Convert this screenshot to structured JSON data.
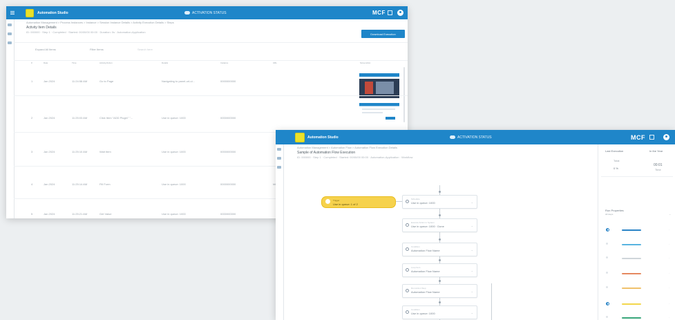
{
  "colors": {
    "background": "#eceff1",
    "topbar": "#1f86c9",
    "primary_button": "#1f86c9",
    "highlight_node": "#f6d24d",
    "legend": [
      "#2a84c6",
      "#58b4e0",
      "#cfd5da",
      "#e5885f",
      "#f0c16b",
      "#f3d64b",
      "#38a67a"
    ]
  },
  "back_window": {
    "topbar": {
      "app_name": "Automation Studio",
      "center_label": "ACTIVATION STATUS",
      "brand": "MCF",
      "icons": [
        "menu-icon",
        "app-logo-icon",
        "cloud-icon",
        "expand-icon",
        "user-avatar-icon"
      ]
    },
    "breadcrumb": "Automation Management  >  Process Instances  >  Instance  >  Session Instance Details  >  Activity Execution Details  >  Steps",
    "page_title": "Activity Item Details",
    "meta_line": "ID: 000000  ·  Step 1  ·  Completed  ·  Started: 00/00/00 00:00  ·  Duration: 0s  ·  Automation-Application",
    "primary_button": "Download Execution",
    "toolbar": {
      "action_1": "Expand All Items",
      "action_2": "Filter Items",
      "search_placeholder": "Search here"
    },
    "table": {
      "columns": [
        "#",
        "Date",
        "Time",
        "Activity/Action",
        "Details",
        "Instance",
        "URL",
        "Screenshot"
      ],
      "rows": [
        {
          "index": "1",
          "date": "Jan 2024",
          "time": "11:24:58 AM",
          "action": "Go to Page",
          "details": "Navigating to panel-url-ui...",
          "instance": "0000000000",
          "url": "",
          "thumb": "thumb-1"
        },
        {
          "index": "2",
          "date": "Jan 2024",
          "time": "11:25:03 AM",
          "action": "Click Item \"ADD Plugin\" \"...",
          "details": "Use in queue: 1000",
          "instance": "0000000000",
          "url": "",
          "thumb": "thumb-2"
        },
        {
          "index": "3",
          "date": "Jan 2024",
          "time": "11:25:10 AM",
          "action": "Wait Item",
          "details": "Use in queue: 1000",
          "instance": "0000000000",
          "url": "",
          "thumb": ""
        },
        {
          "index": "4",
          "date": "Jan 2024",
          "time": "11:25:14 AM",
          "action": "Fill Form",
          "details": "Use in queue: 1000",
          "instance": "0000000000",
          "url": "http...",
          "thumb": ""
        },
        {
          "index": "5",
          "date": "Jan 2024",
          "time": "11:25:21 AM",
          "action": "Get Value",
          "details": "Use in queue: 1000",
          "instance": "0000000000",
          "url": "",
          "thumb": ""
        }
      ]
    },
    "sidebar_icons": [
      "home-icon",
      "list-icon",
      "chart-icon"
    ]
  },
  "front_window": {
    "topbar": {
      "app_name": "Automation Studio",
      "center_label": "ACTIVATION STATUS",
      "brand": "MCF",
      "icons": [
        "app-logo-icon",
        "cloud-icon",
        "expand-icon",
        "user-avatar-icon"
      ]
    },
    "breadcrumb": "Automation Management  >  Automation Flow  >  Automation Flow Execution Details",
    "page_title": "Sample of Automation Flow Execution",
    "meta_line": "ID: 000000  ·  Step 1  ·  Completed  ·  Started: 00/00/00 00:00  ·  Automation-Application  ·  Workflow",
    "highlight_node": {
      "label": "Trigger",
      "value": "Use in queue: 1 of 2"
    },
    "nodes": [
      {
        "label": "Schedule",
        "value": "Use in queue: 1000",
        "icon": "calendar-icon"
      },
      {
        "label": "Execute Action in System",
        "value": "Use in queue: 1000 · Done",
        "icon": "action-icon"
      },
      {
        "label": "Condition",
        "value": "Automation Flow Name",
        "icon": "condition-icon"
      },
      {
        "label": "Loop Item",
        "value": "Automation Flow Name",
        "icon": "loop-icon"
      },
      {
        "label": "Run Action Step",
        "value": "Automation Flow Name",
        "icon": "run-icon"
      },
      {
        "label": "Condition",
        "value": "Use in queue: 1000",
        "icon": "condition-icon"
      }
    ],
    "right_panel": {
      "tab_1": "Last Execution",
      "tab_2": "In the Year",
      "stat_1_label": "Total",
      "stat_1_value": "0 %",
      "stat_2_value": "00:01",
      "stat_2_sub": "Time",
      "section_title": "Run Properties",
      "section_sub": "All steps",
      "legend_items": 7
    },
    "sidebar_icons": [
      "home-icon",
      "list-icon",
      "chart-icon"
    ]
  }
}
